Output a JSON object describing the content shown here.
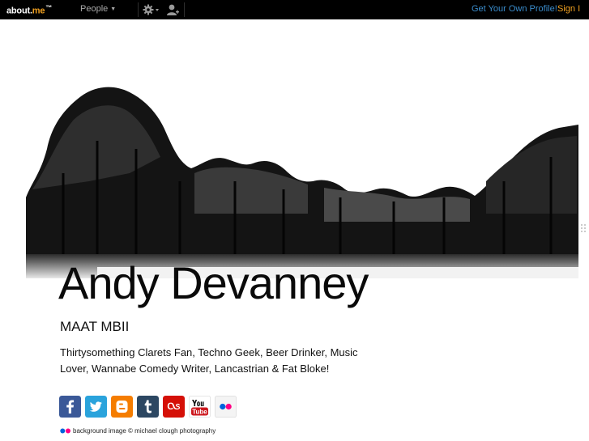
{
  "topbar": {
    "logo_main": "about.",
    "logo_accent": "me",
    "logo_tm": "™",
    "people_label": "People",
    "get_profile_label": "Get Your Own Profile!",
    "sign_in_label": "Sign I"
  },
  "profile": {
    "name": "Andy Devanney",
    "headline": "MAAT MBII",
    "bio": "Thirtysomething Clarets Fan, Techno Geek, Beer Drinker, Music Lover, Wannabe Comedy Writer, Lancastrian & Fat Bloke!"
  },
  "social": [
    {
      "icon": "facebook-icon",
      "color": "#3b5998"
    },
    {
      "icon": "twitter-icon",
      "color": "#2aa3dc"
    },
    {
      "icon": "blogger-icon",
      "color": "#f57d00"
    },
    {
      "icon": "tumblr-icon",
      "color": "#2c4762"
    },
    {
      "icon": "lastfm-icon",
      "color": "#d51007"
    },
    {
      "icon": "youtube-icon",
      "color": "#cc181e"
    },
    {
      "icon": "flickr-icon",
      "color": "#f4f4f4"
    }
  ],
  "credit": {
    "text": "background image © michael clough photography"
  }
}
